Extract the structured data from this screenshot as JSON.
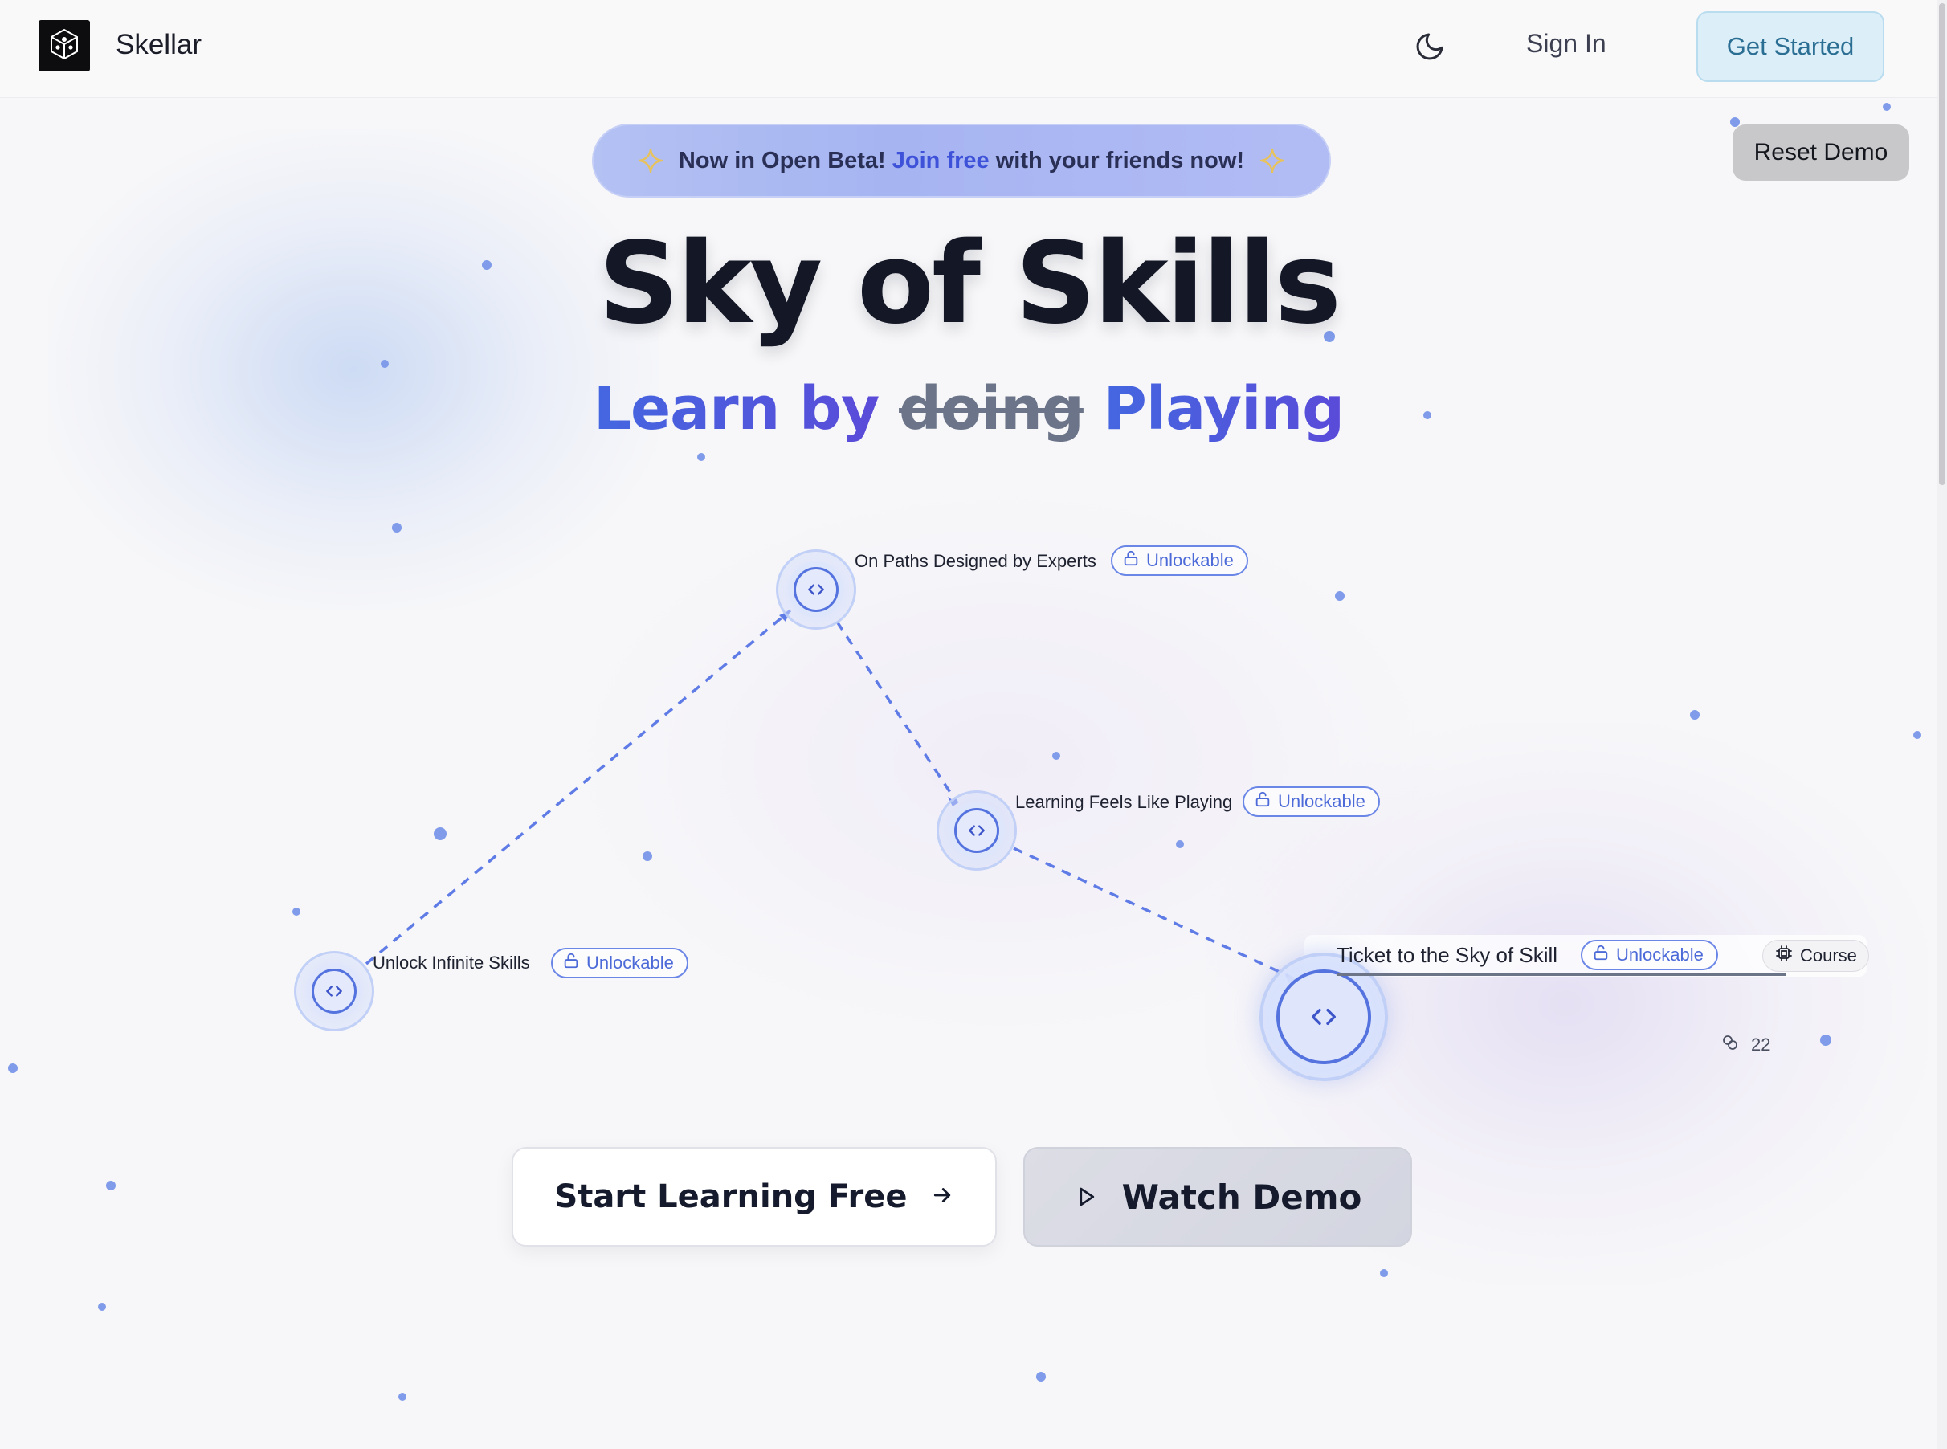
{
  "nav": {
    "brand": "Skellar",
    "sign_in": "Sign In",
    "get_started": "Get Started",
    "reset_demo": "Reset Demo"
  },
  "beta": {
    "part1": "Now in Open Beta!",
    "part2": "Join free",
    "part3": "with",
    "part4": "your friends now!"
  },
  "hero": {
    "title": "Sky of Skills",
    "sub_prefix": "Learn by",
    "sub_strike": "doing",
    "sub_suffix": "Playing"
  },
  "skill_nodes": [
    {
      "label": "Unlock Infinite Skills",
      "badge": "Unlockable"
    },
    {
      "label": "On Paths Designed by Experts",
      "badge": "Unlockable"
    },
    {
      "label": "Learning Feels Like Playing",
      "badge": "Unlockable"
    }
  ],
  "course": {
    "title": "Ticket to the Sky of Skill",
    "badge": "Unlockable",
    "type": "Course",
    "count": "22"
  },
  "cta": {
    "primary": "Start Learning Free",
    "secondary": "Watch Demo"
  },
  "colors": {
    "accent": "#4c6ad8",
    "get_started_bg": "#dceef8",
    "primary_text": "#151a2c"
  },
  "icons": [
    "logo-icon",
    "moon-icon",
    "sparkle-icon",
    "code-icon",
    "lock-icon",
    "chip-icon",
    "link-icon",
    "arrow-right-icon",
    "play-icon"
  ]
}
